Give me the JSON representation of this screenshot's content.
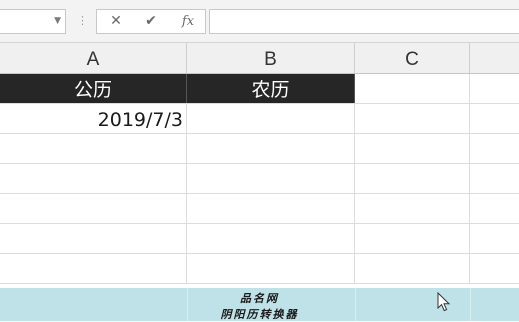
{
  "formula_bar": {
    "name_box_value": "",
    "cancel_symbol": "✕",
    "enter_symbol": "✔",
    "fx_label": "fx",
    "formula_value": ""
  },
  "columns": [
    "A",
    "B",
    "C"
  ],
  "sheet": {
    "header_row": [
      "公历",
      "农历",
      ""
    ],
    "data_row": [
      "2019/7/3",
      "",
      ""
    ]
  },
  "banner": {
    "line1": "品名网",
    "line2": "阴阳历转换器"
  },
  "colors": {
    "header_fill": "#262626",
    "banner_fill": "#bfe1e8"
  },
  "icons": {
    "cursor": "mouse-pointer-icon"
  }
}
